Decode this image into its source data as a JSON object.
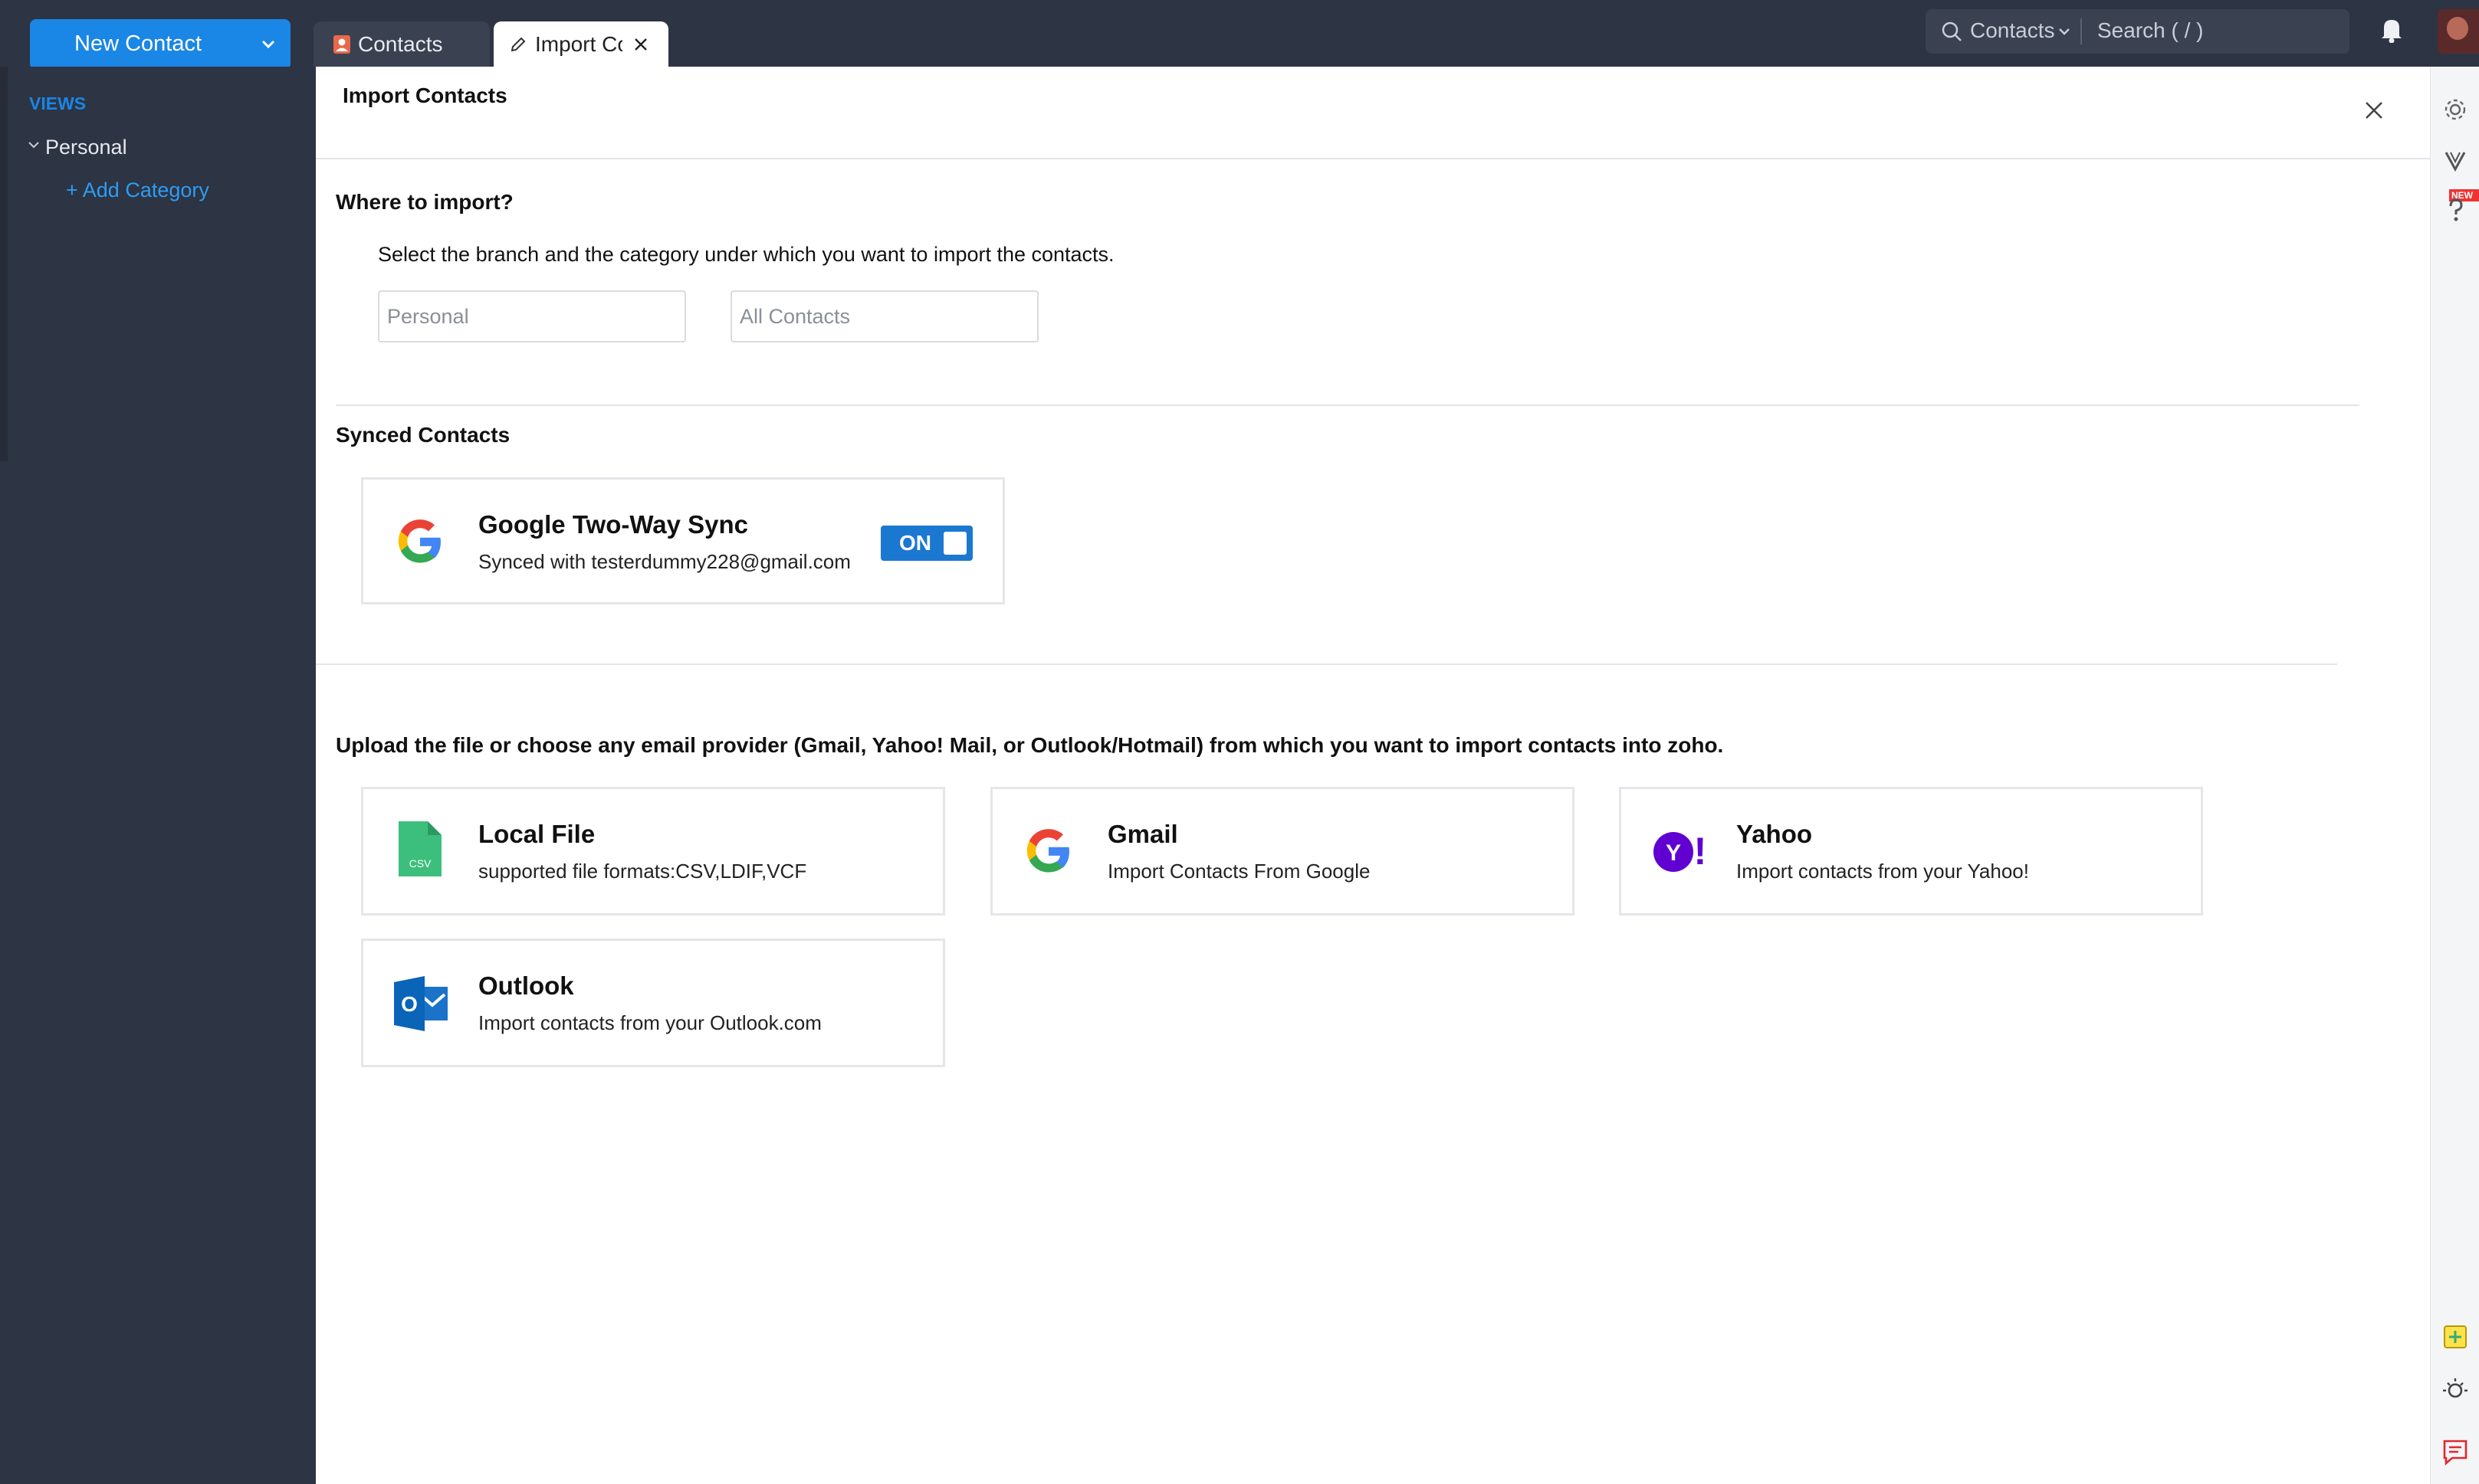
{
  "topbar": {
    "new_contact_label": "New Contact",
    "tabs": [
      {
        "label": "Contacts"
      },
      {
        "label": "Import Co"
      }
    ],
    "search": {
      "scope": "Contacts",
      "placeholder": "Search ( / )"
    }
  },
  "sidebar": {
    "views_label": "VIEWS",
    "personal_label": "Personal",
    "add_category_label": "+ Add Category"
  },
  "panel": {
    "title": "Import Contacts",
    "where_heading": "Where to import?",
    "where_desc": "Select the branch and the category under which you want to import the contacts.",
    "branch_select": "Personal",
    "category_select": "All Contacts",
    "synced_heading": "Synced Contacts",
    "google_sync": {
      "title": "Google Two-Way Sync",
      "subtitle": "Synced with testerdummy228@gmail.com",
      "toggle_label": "ON"
    },
    "upload_heading": "Upload the file or choose any email provider (Gmail, Yahoo! Mail, or Outlook/Hotmail) from which you want to import contacts into zoho.",
    "sources": [
      {
        "title": "Local File",
        "subtitle": "supported file formats:CSV,LDIF,VCF",
        "icon": "csv-file-icon",
        "icon_text": "CSV"
      },
      {
        "title": "Gmail",
        "subtitle": "Import Contacts From Google",
        "icon": "google-icon"
      },
      {
        "title": "Yahoo",
        "subtitle": "Import contacts from your Yahoo!",
        "icon": "yahoo-icon",
        "icon_text": "Y!"
      },
      {
        "title": "Outlook",
        "subtitle": "Import contacts from your Outlook.com",
        "icon": "outlook-icon",
        "icon_text": "O"
      }
    ]
  },
  "rightbar": {
    "new_badge": "NEW"
  },
  "colors": {
    "accent": "#1a86e5",
    "sidebar_bg": "#2d3443",
    "toggle_on": "#1b78d1"
  }
}
